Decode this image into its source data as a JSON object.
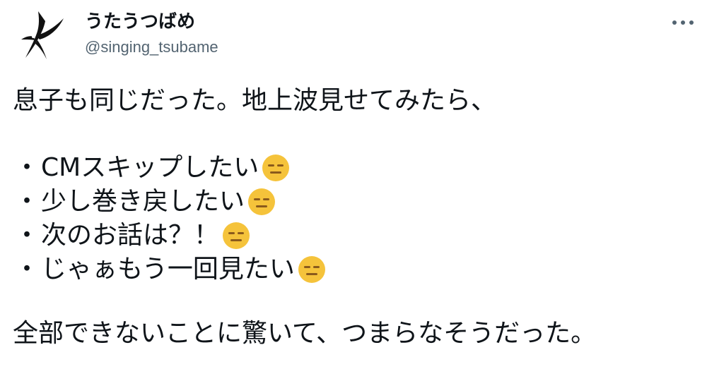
{
  "author": {
    "display_name": "うたうつばめ",
    "handle": "@singing_tsubame",
    "avatar_icon": "swallow-bird-icon"
  },
  "more_icon": "more-options-icon",
  "tweet": {
    "intro": "息子も同じだった。地上波見せてみたら、",
    "bullet_char": "・",
    "list": [
      "CMスキップしたい",
      "少し巻き戻したい",
      "次のお話は？！",
      "じゃぁもう一回見たい"
    ],
    "emoji_icon": "expressionless-face-emoji",
    "conclusion": "全部できないことに驚いて、つまらなそうだった。"
  },
  "colors": {
    "emoji_face": "#f5c33b",
    "emoji_features": "#8a5a1c",
    "handle": "#536471",
    "text": "#0f1419"
  }
}
